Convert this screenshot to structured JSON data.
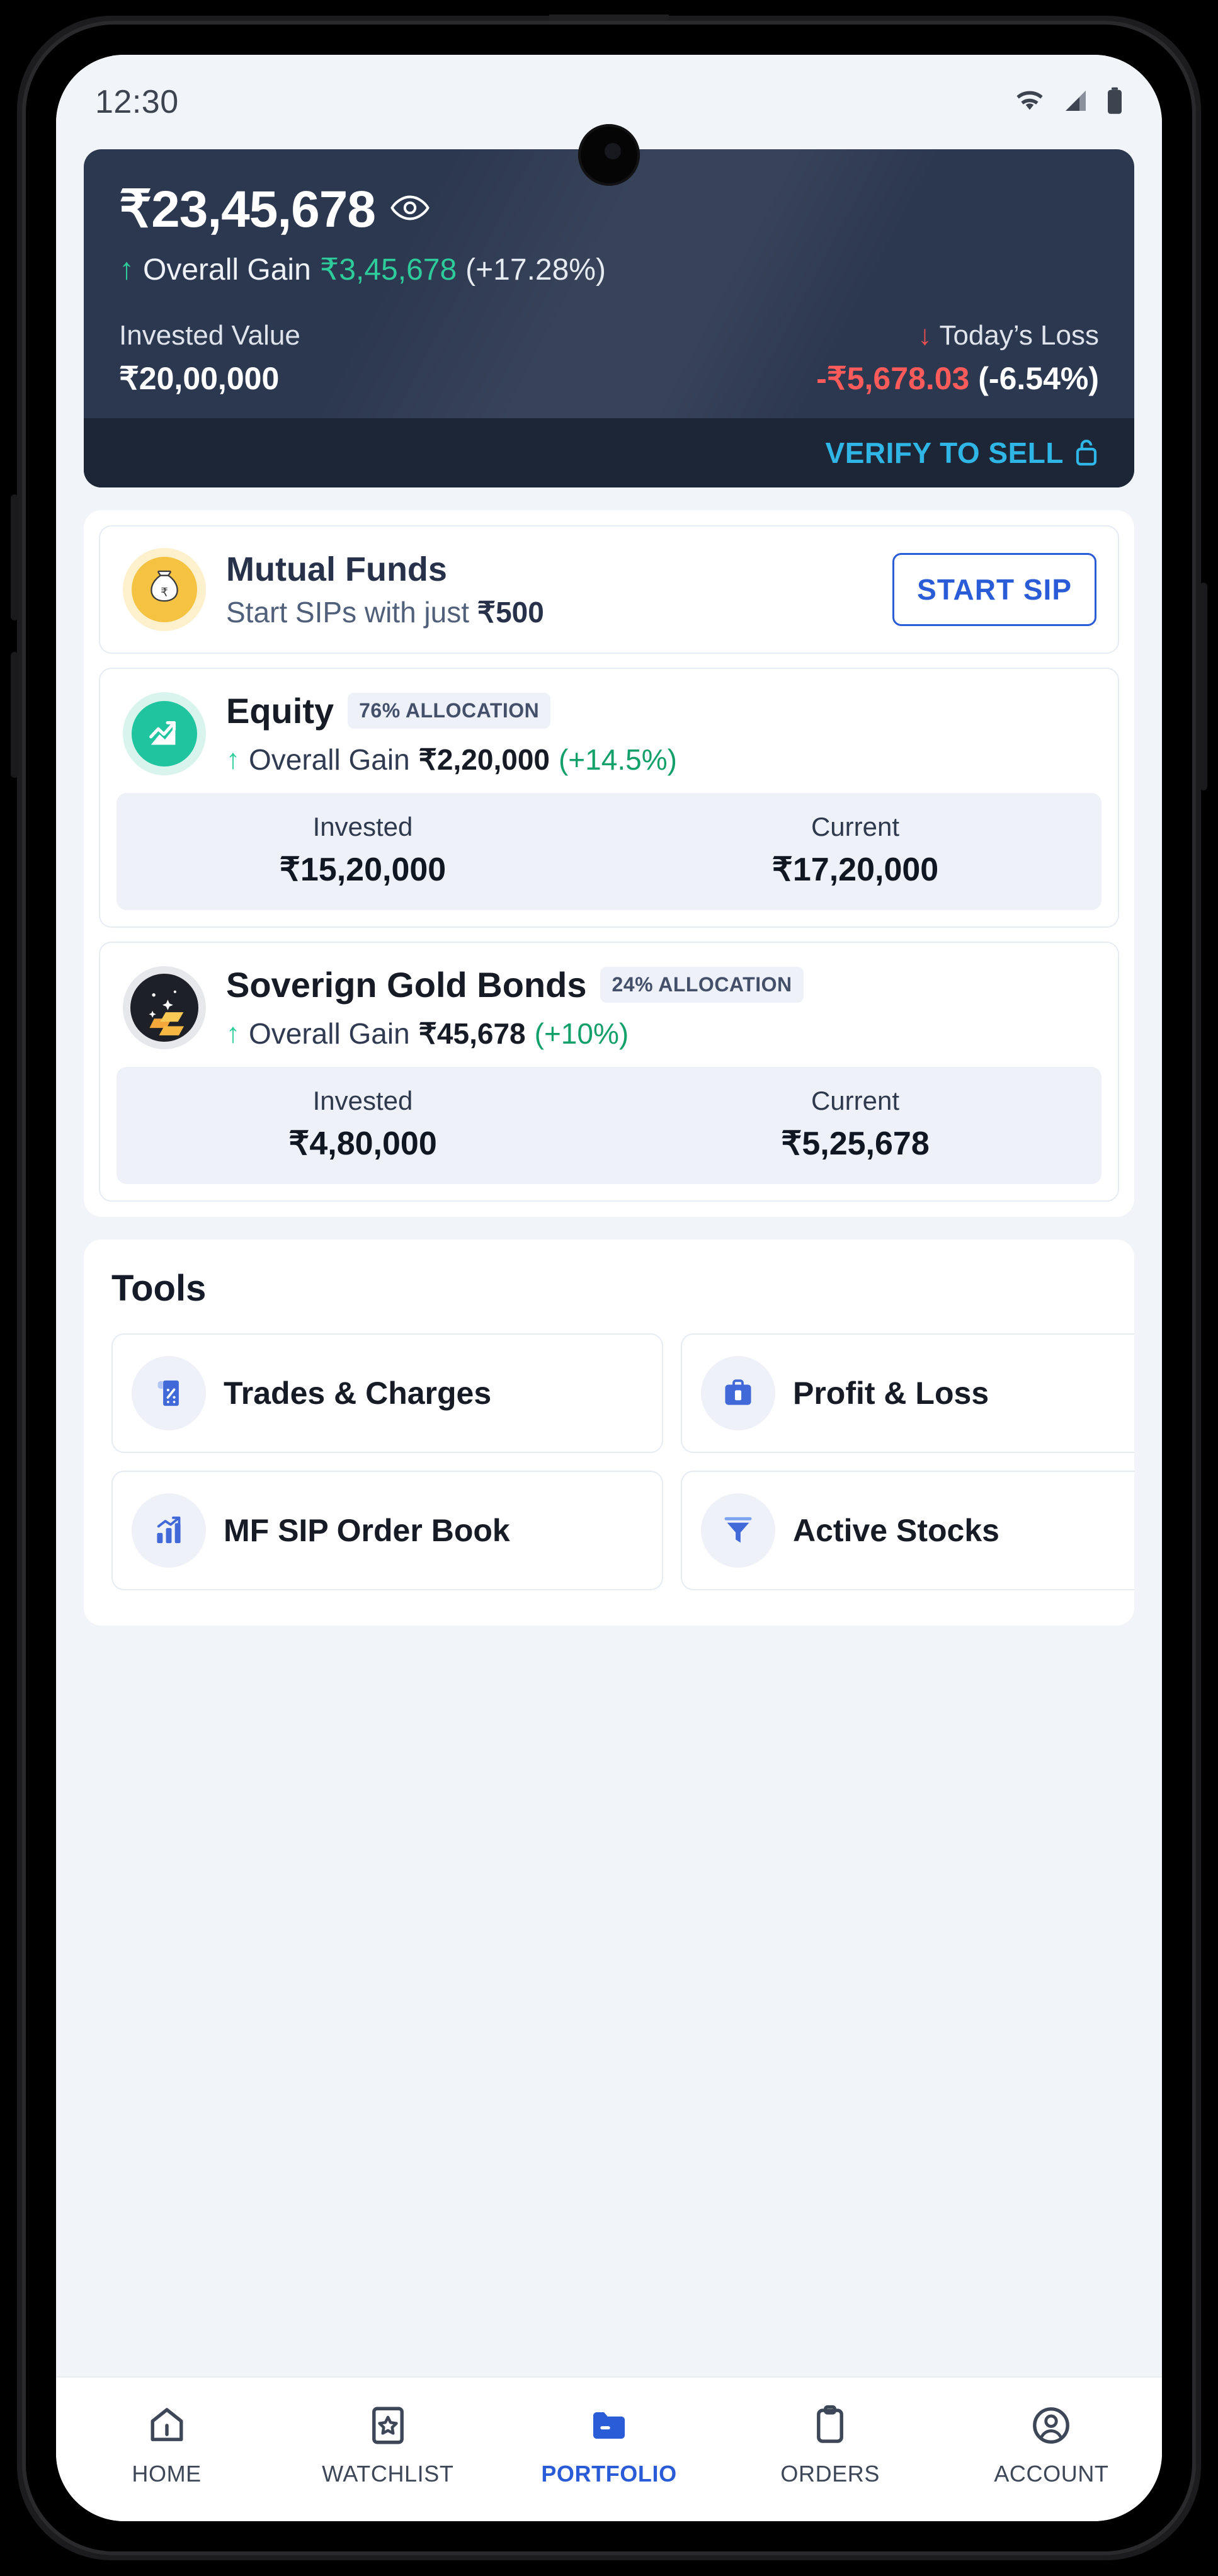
{
  "status_bar": {
    "time": "12:30",
    "icons": [
      "wifi-icon",
      "cellular-signal-icon",
      "battery-icon"
    ]
  },
  "portfolio_summary": {
    "total_value": "₹23,45,678",
    "eye_icon": "eye-icon",
    "overall_gain_arrow": "↑",
    "overall_gain_label": "Overall Gain",
    "overall_gain_amount": "₹3,45,678",
    "overall_gain_percent": "(+17.28%)",
    "invested_label": "Invested Value",
    "invested_value": "₹20,00,000",
    "todays_arrow": "↓",
    "todays_label": "Today’s Loss",
    "todays_value": "-₹5,678.03",
    "todays_percent": "(-6.54%)",
    "verify_label": "VERIFY TO SELL",
    "lock_icon": "lock-icon",
    "accent_green": "#2ecc9b",
    "accent_red": "#ff5b5b",
    "accent_cyan": "#2fb6e6",
    "card_bg": "#2c3850"
  },
  "mutual_funds": {
    "icon": "money-bag-icon",
    "title": "Mutual Funds",
    "subtitle_prefix": "Start SIPs with just ",
    "subtitle_amount": "₹500",
    "cta_label": "START SIP",
    "cta_color": "#2a5cd7"
  },
  "holdings": [
    {
      "icon": "chart-growth-icon",
      "title": "Equity",
      "allocation_badge": "76% ALLOCATION",
      "gain_arrow": "↑",
      "gain_label": "Overall Gain",
      "gain_amount": "₹2,20,000",
      "gain_percent": "(+14.5%)",
      "invested_label": "Invested",
      "invested_value": "₹15,20,000",
      "current_label": "Current",
      "current_value": "₹17,20,000"
    },
    {
      "icon": "gold-bars-icon",
      "title": "Soverign Gold Bonds",
      "allocation_badge": "24% ALLOCATION",
      "gain_arrow": "↑",
      "gain_label": "Overall Gain",
      "gain_amount": "₹45,678",
      "gain_percent": "(+10%)",
      "invested_label": "Invested",
      "invested_value": "₹4,80,000",
      "current_label": "Current",
      "current_value": "₹5,25,678"
    }
  ],
  "tools": {
    "heading": "Tools",
    "items": [
      {
        "icon": "receipt-icon",
        "label": "Trades & Charges"
      },
      {
        "icon": "briefcase-icon",
        "label": "Profit & Loss"
      },
      {
        "icon": "bar-chart-icon",
        "label": "MF SIP Order Book"
      },
      {
        "icon": "funnel-icon",
        "label": "Active Stocks"
      }
    ]
  },
  "bottom_nav": {
    "active_index": 2,
    "items": [
      {
        "icon": "home-icon",
        "label": "HOME"
      },
      {
        "icon": "watchlist-star-icon",
        "label": "WATCHLIST"
      },
      {
        "icon": "folder-icon",
        "label": "PORTFOLIO"
      },
      {
        "icon": "clipboard-icon",
        "label": "ORDERS"
      },
      {
        "icon": "account-circle-icon",
        "label": "ACCOUNT"
      }
    ],
    "active_color": "#2a5cd7"
  }
}
